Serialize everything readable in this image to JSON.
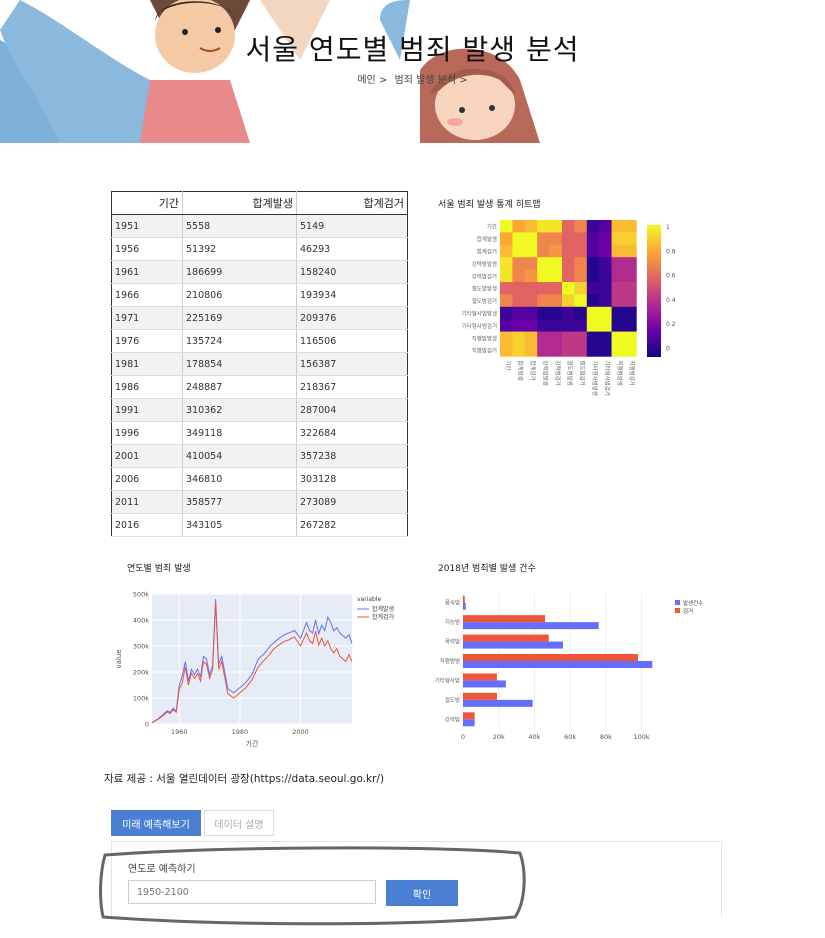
{
  "header": {
    "title": "서울 연도별 범죄 발생 분석",
    "breadcrumb": [
      "메인 >",
      "범죄 발생 분석 >"
    ]
  },
  "table": {
    "columns": [
      "기간",
      "합계발생",
      "합계검거"
    ],
    "rows": [
      [
        "1951",
        "5558",
        "5149"
      ],
      [
        "1956",
        "51392",
        "46293"
      ],
      [
        "1961",
        "186699",
        "158240"
      ],
      [
        "1966",
        "210806",
        "193934"
      ],
      [
        "1971",
        "225169",
        "209376"
      ],
      [
        "1976",
        "135724",
        "116506"
      ],
      [
        "1981",
        "178854",
        "156387"
      ],
      [
        "1986",
        "248887",
        "218367"
      ],
      [
        "1991",
        "310362",
        "287004"
      ],
      [
        "1996",
        "349118",
        "322684"
      ],
      [
        "2001",
        "410054",
        "357238"
      ],
      [
        "2006",
        "346810",
        "303128"
      ],
      [
        "2011",
        "358577",
        "273089"
      ],
      [
        "2016",
        "343105",
        "267282"
      ]
    ]
  },
  "chart_data": [
    {
      "type": "heatmap",
      "title": "서울 범죄 발생 통계 히트맵",
      "labels": [
        "기간",
        "합계발생",
        "합계검거",
        "강력범발생",
        "강력범검거",
        "절도범발생",
        "절도범검거",
        "기타형사범발생",
        "기타형사범검거",
        "직행범발생",
        "직행범검거"
      ],
      "values": [
        [
          1.0,
          0.8,
          0.85,
          0.95,
          0.95,
          0.6,
          0.7,
          0.1,
          0.15,
          0.85,
          0.85
        ],
        [
          0.8,
          1.0,
          1.0,
          0.7,
          0.7,
          0.6,
          0.6,
          0.15,
          0.2,
          0.9,
          0.9
        ],
        [
          0.85,
          1.0,
          1.0,
          0.7,
          0.75,
          0.6,
          0.6,
          0.15,
          0.2,
          0.85,
          0.85
        ],
        [
          0.95,
          0.7,
          0.7,
          1.0,
          1.0,
          0.6,
          0.7,
          0.05,
          0.1,
          0.4,
          0.4
        ],
        [
          0.95,
          0.7,
          0.75,
          1.0,
          1.0,
          0.6,
          0.7,
          0.05,
          0.1,
          0.4,
          0.4
        ],
        [
          0.6,
          0.6,
          0.6,
          0.6,
          0.6,
          1.0,
          0.9,
          0.1,
          0.1,
          0.45,
          0.45
        ],
        [
          0.7,
          0.6,
          0.6,
          0.7,
          0.7,
          0.9,
          1.0,
          0.05,
          0.1,
          0.45,
          0.45
        ],
        [
          0.1,
          0.15,
          0.15,
          0.05,
          0.05,
          0.1,
          0.05,
          1.0,
          1.0,
          0.05,
          0.05
        ],
        [
          0.15,
          0.2,
          0.2,
          0.1,
          0.1,
          0.1,
          0.1,
          1.0,
          1.0,
          0.05,
          0.05
        ],
        [
          0.85,
          0.9,
          0.85,
          0.4,
          0.4,
          0.45,
          0.45,
          0.05,
          0.05,
          1.0,
          1.0
        ],
        [
          0.85,
          0.9,
          0.85,
          0.4,
          0.4,
          0.45,
          0.45,
          0.05,
          0.05,
          1.0,
          1.0
        ]
      ],
      "colorbar_ticks": [
        "1",
        "0.8",
        "0.6",
        "0.4",
        "0.2",
        "0"
      ],
      "colors": [
        "#0d0887",
        "#6a00a8",
        "#b12a90",
        "#e16462",
        "#fca636",
        "#f0f921"
      ]
    },
    {
      "type": "line",
      "title": "연도별 범죄 발생",
      "xlabel": "기간",
      "ylabel": "value",
      "xlim": [
        1951,
        2017
      ],
      "ylim": [
        0,
        500000
      ],
      "x_ticks": [
        "1960",
        "1980",
        "2000"
      ],
      "y_ticks": [
        "0",
        "100k",
        "200k",
        "300k",
        "400k",
        "500k"
      ],
      "legend_title": "variable",
      "series": [
        {
          "name": "합계발생",
          "color": "#636efa",
          "x": [
            1951,
            1953,
            1955,
            1956,
            1957,
            1958,
            1959,
            1960,
            1961,
            1962,
            1963,
            1964,
            1965,
            1966,
            1967,
            1968,
            1969,
            1970,
            1971,
            1972,
            1973,
            1974,
            1975,
            1976,
            1978,
            1980,
            1982,
            1984,
            1986,
            1988,
            1990,
            1991,
            1993,
            1995,
            1996,
            1998,
            2000,
            2002,
            2003,
            2004,
            2005,
            2006,
            2007,
            2008,
            2009,
            2010,
            2011,
            2012,
            2013,
            2014,
            2015,
            2016,
            2017
          ],
          "values": [
            5558,
            20000,
            40000,
            51392,
            45000,
            60000,
            50000,
            150000,
            186699,
            240000,
            165000,
            210000,
            190000,
            210806,
            180000,
            260000,
            250000,
            190000,
            225169,
            480000,
            230000,
            260000,
            200000,
            135724,
            120000,
            140000,
            160000,
            190000,
            248887,
            270000,
            300000,
            310362,
            330000,
            345000,
            349118,
            360000,
            330000,
            390000,
            360000,
            350000,
            400000,
            346810,
            380000,
            360000,
            410054,
            390000,
            358577,
            370000,
            350000,
            340000,
            330000,
            343105,
            310000
          ]
        },
        {
          "name": "합계검거",
          "color": "#ef553b",
          "x": [
            1951,
            1953,
            1955,
            1956,
            1957,
            1958,
            1959,
            1960,
            1961,
            1962,
            1963,
            1964,
            1965,
            1966,
            1967,
            1968,
            1969,
            1970,
            1971,
            1972,
            1973,
            1974,
            1975,
            1976,
            1978,
            1980,
            1982,
            1984,
            1986,
            1988,
            1990,
            1991,
            1993,
            1995,
            1996,
            1998,
            2000,
            2002,
            2003,
            2004,
            2005,
            2006,
            2007,
            2008,
            2009,
            2010,
            2011,
            2012,
            2013,
            2014,
            2015,
            2016,
            2017
          ],
          "values": [
            5149,
            18000,
            35000,
            46293,
            40000,
            55000,
            45000,
            135000,
            158240,
            220000,
            150000,
            195000,
            175000,
            193934,
            165000,
            240000,
            230000,
            175000,
            209376,
            470000,
            210000,
            240000,
            180000,
            116506,
            100000,
            120000,
            140000,
            170000,
            218367,
            245000,
            270000,
            287004,
            305000,
            320000,
            322684,
            335000,
            300000,
            350000,
            320000,
            310000,
            357238,
            303128,
            330000,
            300000,
            320000,
            290000,
            273089,
            290000,
            260000,
            250000,
            240000,
            267282,
            240000
          ]
        }
      ]
    },
    {
      "type": "bar",
      "orientation": "horizontal",
      "title": "2018년 범죄별 발생 건수",
      "categories": [
        "강력범",
        "절도범",
        "기타형사범",
        "직행범범",
        "폭력범",
        "지능범",
        "풍속범"
      ],
      "xlim": [
        0,
        112000
      ],
      "x_ticks": [
        "0",
        "20k",
        "40k",
        "60k",
        "80k",
        "100k"
      ],
      "series": [
        {
          "name": "발생건수",
          "color": "#636efa",
          "values": [
            6500,
            39000,
            24000,
            106000,
            56000,
            76000,
            1500
          ]
        },
        {
          "name": "검거",
          "color": "#ef553b",
          "values": [
            6500,
            19000,
            19000,
            98000,
            48000,
            46000,
            1000
          ]
        }
      ]
    }
  ],
  "footer": {
    "source": "자료 제공 : 서울 열린데이터 광장(https://data.seoul.go.kr/)",
    "tab_predict": "미래 예측해보기",
    "tab_description": "데이터 설명",
    "panel_label": "연도로 예측하기",
    "input_placeholder": "1950-2100",
    "confirm_label": "확인"
  }
}
